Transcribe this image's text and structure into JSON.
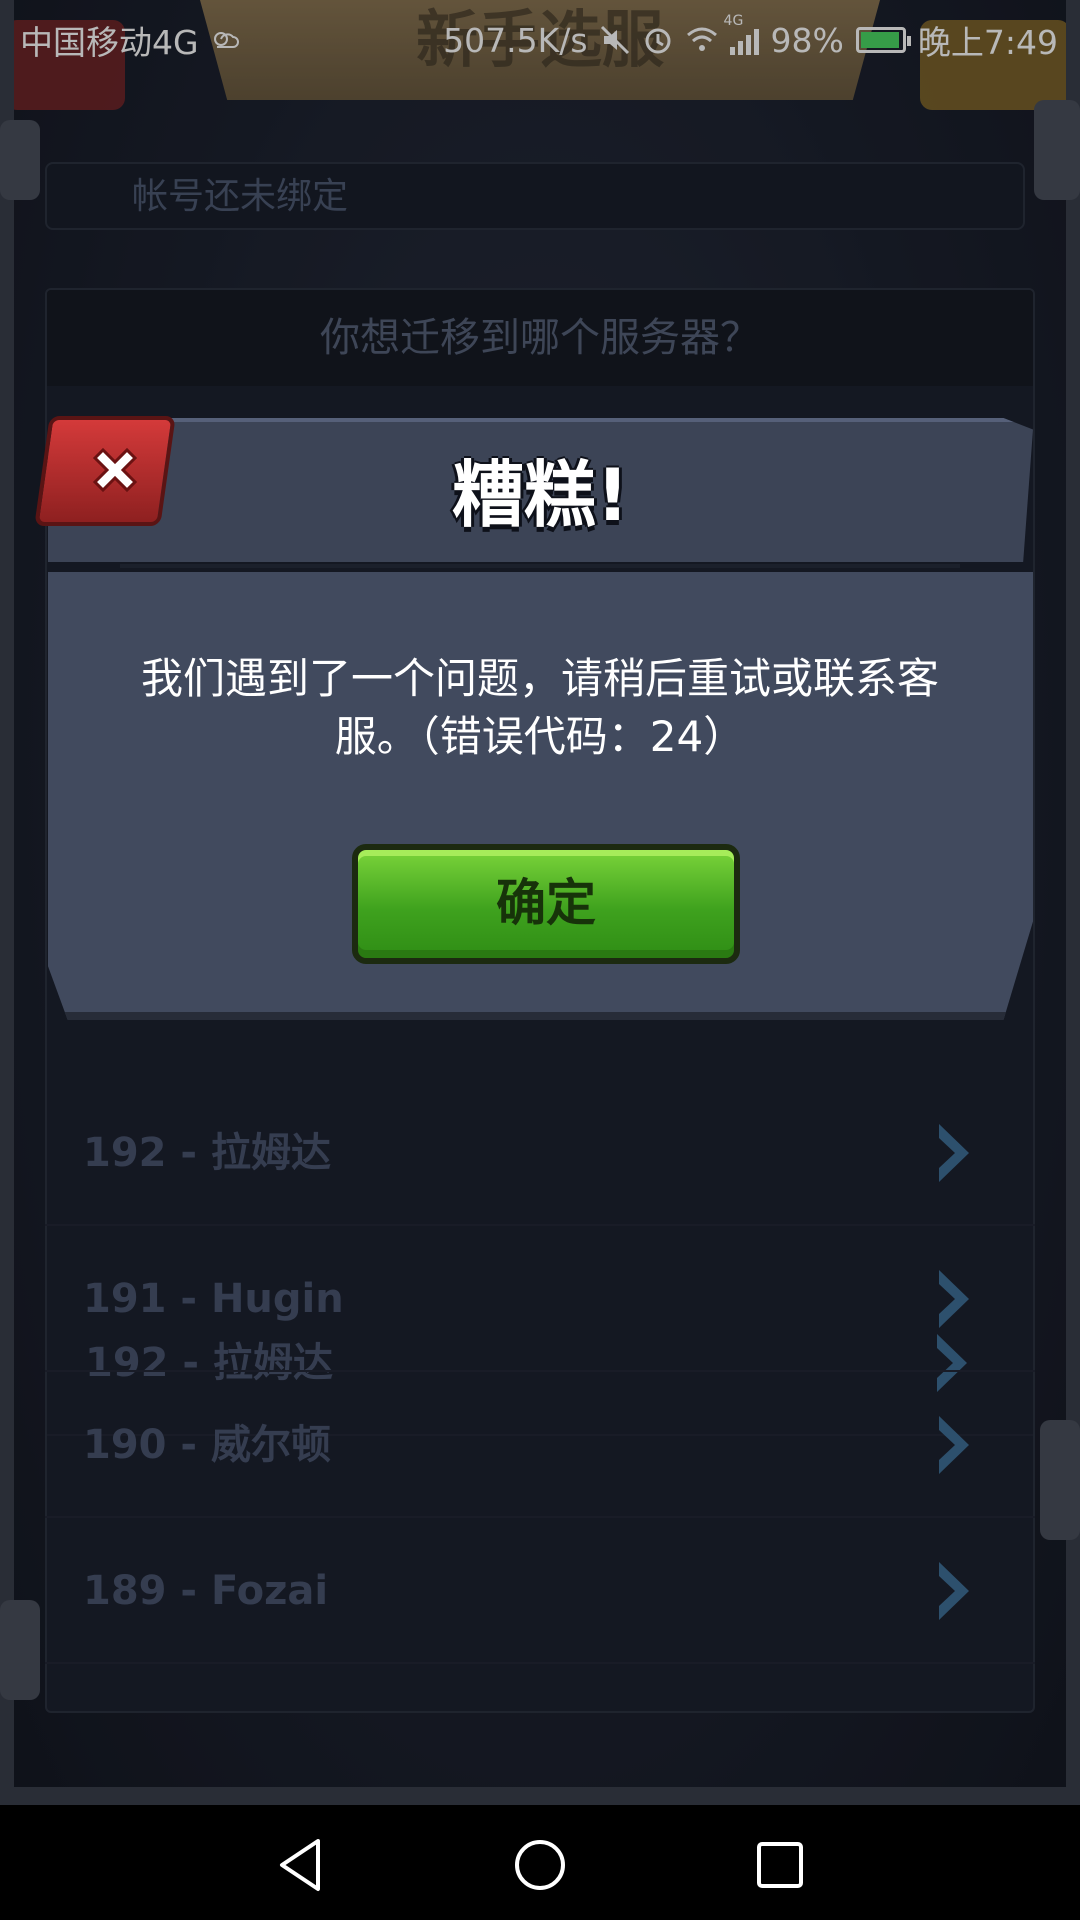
{
  "status_bar": {
    "carrier": "中国移动4G",
    "net_speed": "507.5K/s",
    "network_tag": "4G",
    "battery": "98%",
    "time": "晚上7:49"
  },
  "header": {
    "title": "新手选服"
  },
  "account": {
    "status_text": "帐号还未绑定"
  },
  "server_list": {
    "prompt": "你想迁移到哪个服务器？",
    "items": [
      {
        "label": "192 - 拉姆达"
      },
      {
        "label": "191 - Hugin"
      },
      {
        "label": "190 - 威尔顿"
      },
      {
        "label": "189 - Fozai"
      }
    ]
  },
  "dialog": {
    "title": "糟糕!",
    "message": "我们遇到了一个问题，请稍后重试或联系客服。（错误代码：24）",
    "ok_label": "确定"
  },
  "colors": {
    "ok_button": "#3fa21e",
    "close_button": "#c62f2f",
    "modal_bg": "#414a5e"
  },
  "icons": {
    "close": "close-icon",
    "back": "back-icon",
    "home": "home-icon",
    "recents": "recents-icon"
  }
}
